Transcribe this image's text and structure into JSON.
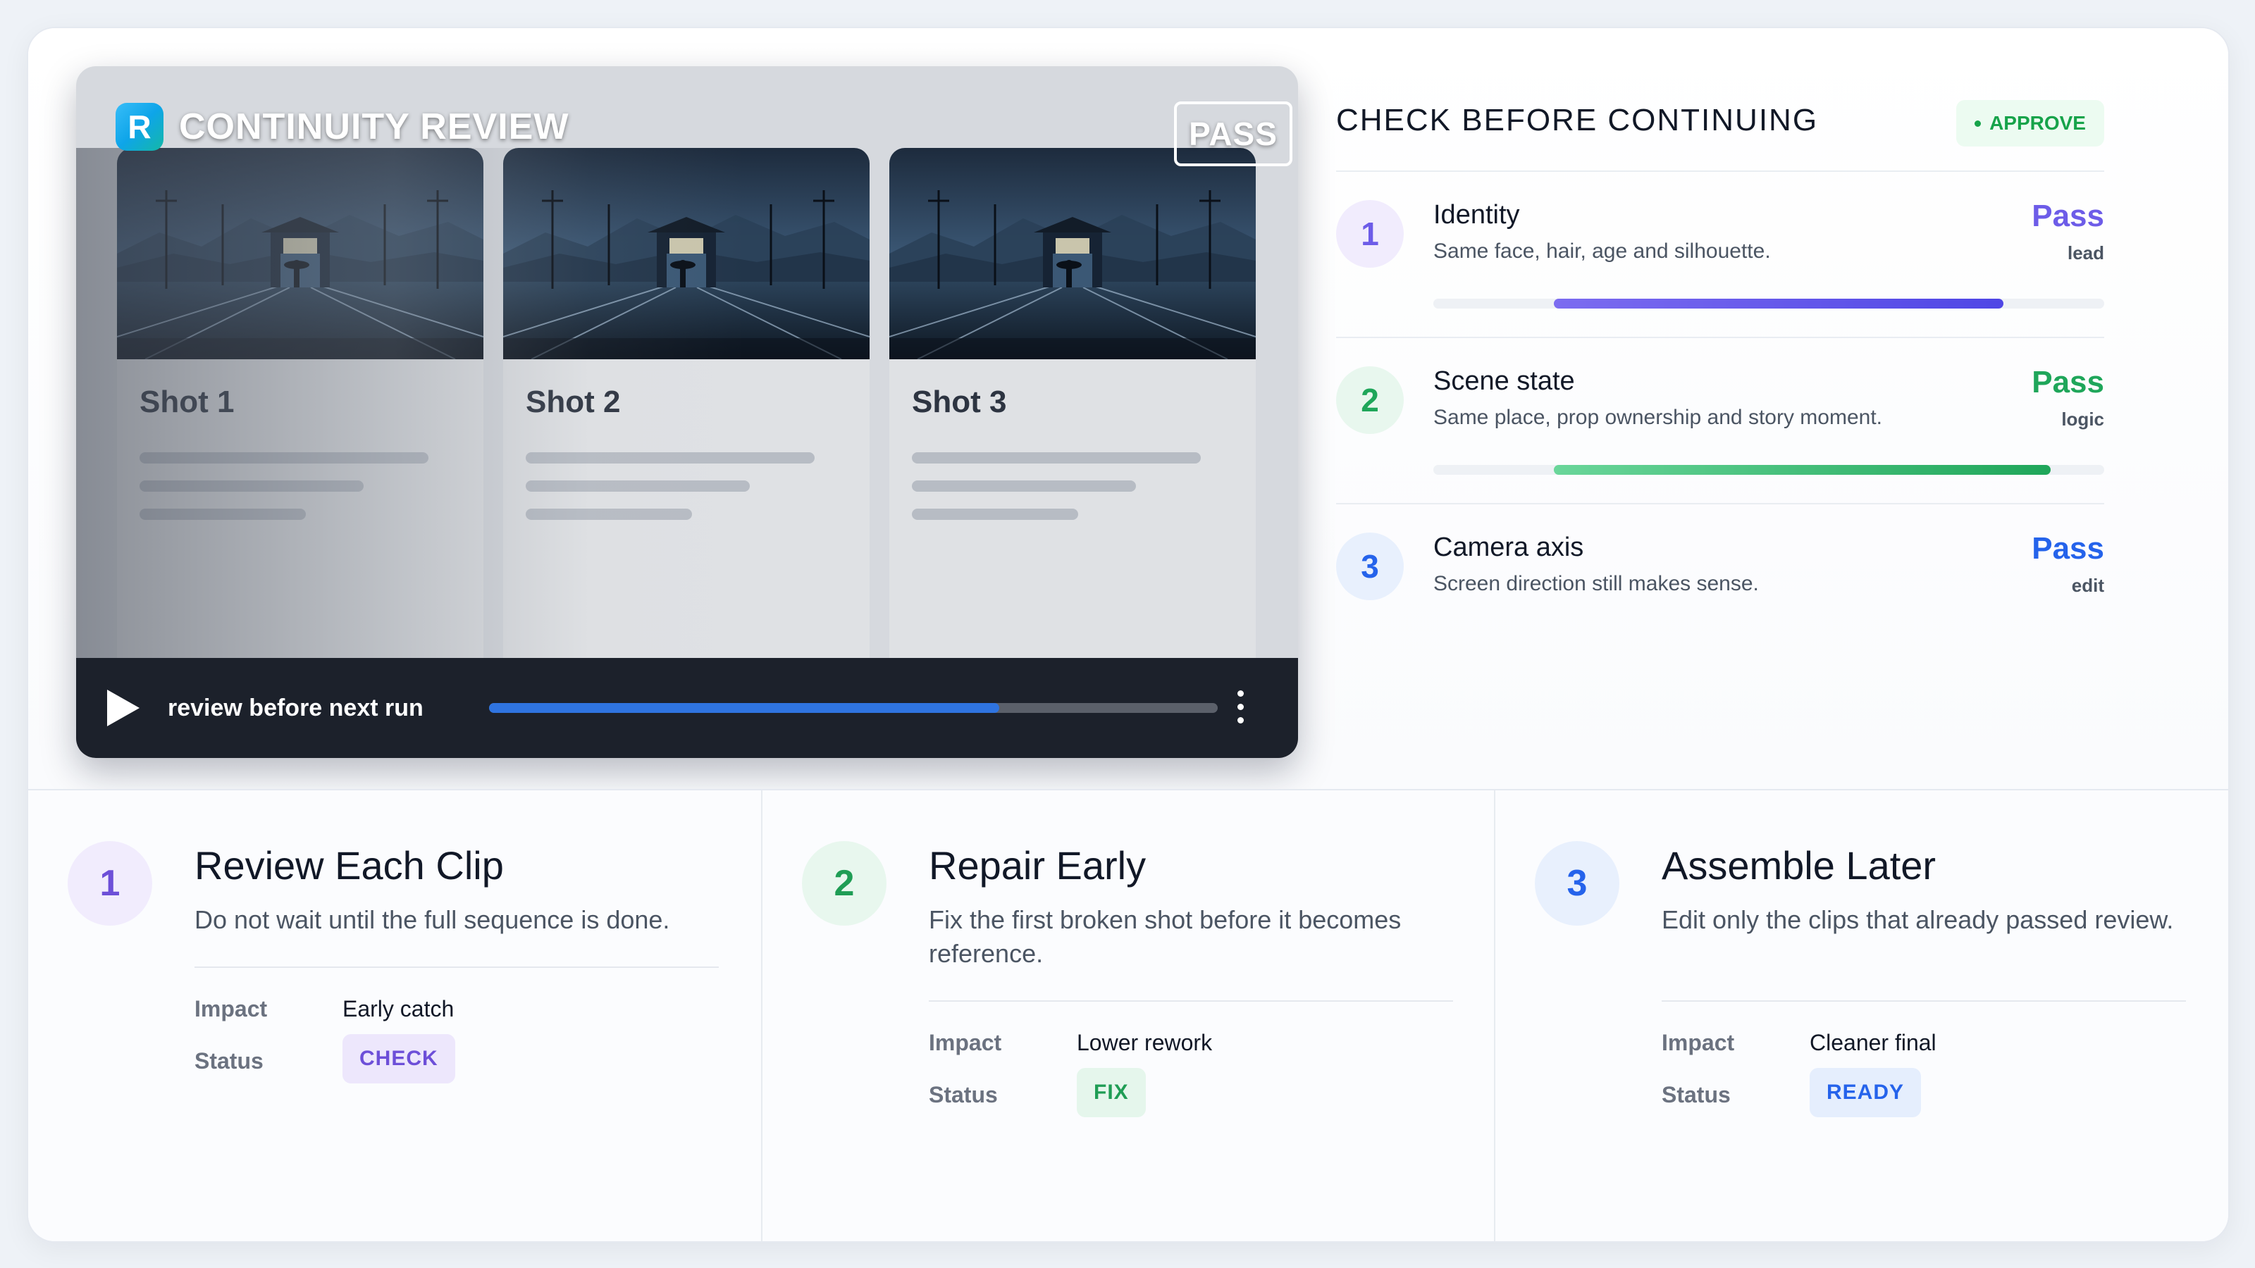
{
  "player": {
    "brand_letter": "R",
    "title": "CONTINUITY REVIEW",
    "stamp": "PASS",
    "shots": [
      {
        "label": "Shot 1"
      },
      {
        "label": "Shot 2"
      },
      {
        "label": "Shot 3"
      }
    ],
    "control_label": "review before next run",
    "progress_fraction": 0.7
  },
  "checklist": {
    "title": "CHECK BEFORE CONTINUING",
    "approve_label": "APPROVE",
    "items": [
      {
        "num": "1",
        "title": "Identity",
        "desc": "Same face, hair, age and silhouette.",
        "result": "Pass",
        "role": "lead",
        "color": "#6d5ce8",
        "bar_start": 0.18,
        "bar_end": 0.85
      },
      {
        "num": "2",
        "title": "Scene state",
        "desc": "Same place, prop ownership and story moment.",
        "result": "Pass",
        "role": "logic",
        "color": "#1fa65a",
        "bar_start": 0.18,
        "bar_end": 0.92
      },
      {
        "num": "3",
        "title": "Camera axis",
        "desc": "Screen direction still makes sense.",
        "result": "Pass",
        "role": "edit",
        "color": "#2563eb"
      }
    ]
  },
  "steps": [
    {
      "num": "1",
      "title": "Review Each Clip",
      "desc": "Do not wait until the full sequence is done.",
      "impact_key": "Impact",
      "impact": "Early catch",
      "status_key": "Status",
      "status": "CHECK",
      "color": "#6d4fd8",
      "circle_bg": "#f1ecfd",
      "badge_bg": "#ede7fc"
    },
    {
      "num": "2",
      "title": "Repair Early",
      "desc": "Fix the first broken shot before it becomes reference.",
      "impact_key": "Impact",
      "impact": "Lower rework",
      "status_key": "Status",
      "status": "FIX",
      "color": "#1f9d55",
      "circle_bg": "#e8f7ee",
      "badge_bg": "#e5f6ec"
    },
    {
      "num": "3",
      "title": "Assemble Later",
      "desc": "Edit only the clips that already passed review.",
      "impact_key": "Impact",
      "impact": "Cleaner final",
      "status_key": "Status",
      "status": "READY",
      "color": "#2563eb",
      "circle_bg": "#e8f0fd",
      "badge_bg": "#e5eefd"
    }
  ]
}
